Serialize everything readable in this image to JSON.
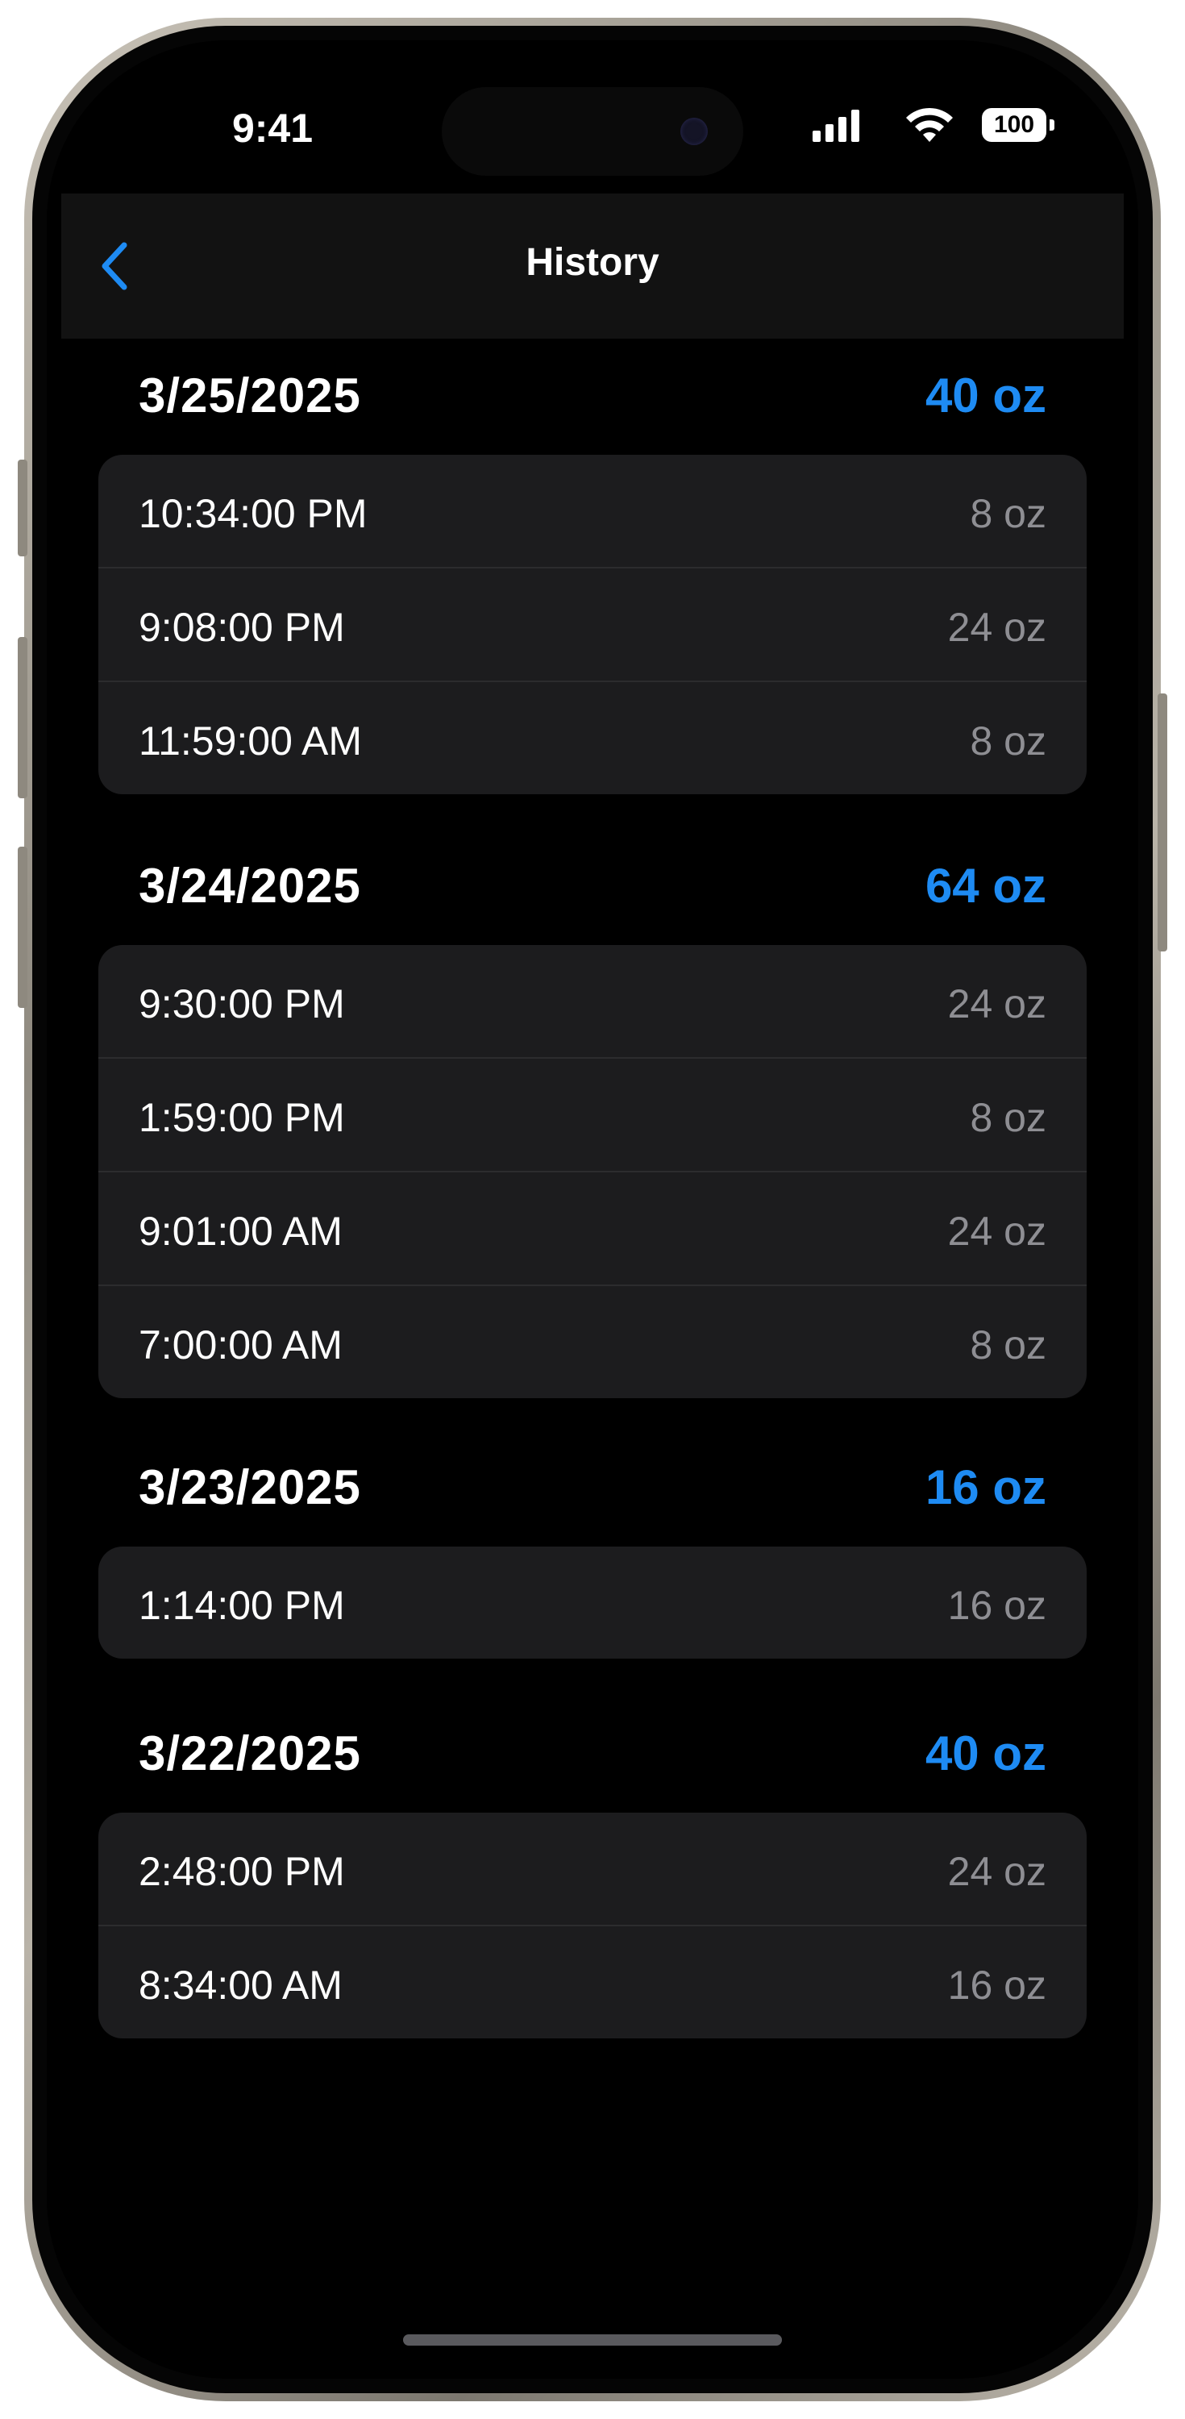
{
  "status_bar": {
    "time": "9:41",
    "battery": "100"
  },
  "nav": {
    "title": "History",
    "back_icon": "chevron-left-icon"
  },
  "colors": {
    "accent": "#1e8bf3",
    "background": "#000000",
    "card": "#1c1c1e",
    "secondary_text": "#8e8e93"
  },
  "sections": [
    {
      "date": "3/25/2025",
      "total": "40 oz",
      "entries": [
        {
          "time": "10:34:00 PM",
          "amount": "8 oz"
        },
        {
          "time": "9:08:00 PM",
          "amount": "24 oz"
        },
        {
          "time": "11:59:00 AM",
          "amount": "8 oz"
        }
      ]
    },
    {
      "date": "3/24/2025",
      "total": "64 oz",
      "entries": [
        {
          "time": "9:30:00 PM",
          "amount": "24 oz"
        },
        {
          "time": "1:59:00 PM",
          "amount": "8 oz"
        },
        {
          "time": "9:01:00 AM",
          "amount": "24 oz"
        },
        {
          "time": "7:00:00 AM",
          "amount": "8 oz"
        }
      ]
    },
    {
      "date": "3/23/2025",
      "total": "16 oz",
      "entries": [
        {
          "time": "1:14:00 PM",
          "amount": "16 oz"
        }
      ]
    },
    {
      "date": "3/22/2025",
      "total": "40 oz",
      "entries": [
        {
          "time": "2:48:00 PM",
          "amount": "24 oz"
        },
        {
          "time": "8:34:00 AM",
          "amount": "16 oz"
        }
      ]
    }
  ]
}
